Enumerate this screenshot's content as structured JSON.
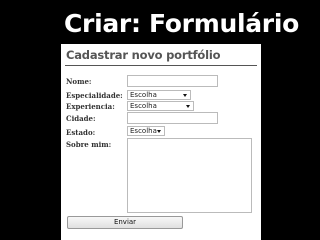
{
  "slide": {
    "title": "Criar: Formulário"
  },
  "form": {
    "heading": "Cadastrar novo portfólio",
    "fields": {
      "nome": {
        "label": "Nome:",
        "value": ""
      },
      "especialidade": {
        "label": "Especialidade:",
        "selected": "Escolha"
      },
      "experiencia": {
        "label": "Experiencia:",
        "selected": "Escolha"
      },
      "cidade": {
        "label": "Cidade:",
        "value": ""
      },
      "estado": {
        "label": "Estado:",
        "selected": "Escolha"
      },
      "sobre": {
        "label": "Sobre mim:",
        "value": ""
      }
    },
    "submit_label": "Enviar"
  }
}
